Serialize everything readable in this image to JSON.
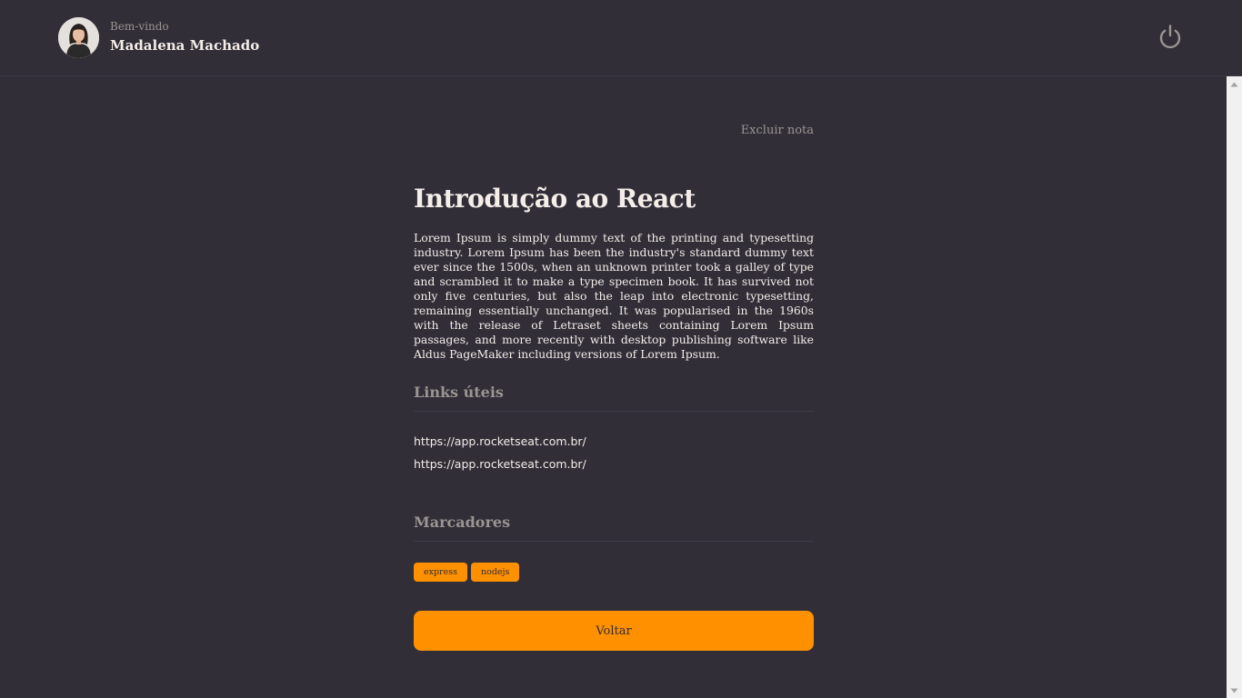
{
  "header": {
    "welcome_label": "Bem-vindo",
    "user_name": "Madalena Machado"
  },
  "note": {
    "delete_label": "Excluir nota",
    "title": "Introdução ao React",
    "body": "Lorem Ipsum is simply dummy text of the printing and typesetting industry. Lorem Ipsum has been the industry's standard dummy text ever since the 1500s, when an unknown printer took a galley of type and scrambled it to make a type specimen book. It has survived not only five centuries, but also the leap into electronic typesetting, remaining essentially unchanged. It was popularised in the 1960s with the release of Letraset sheets containing Lorem Ipsum passages, and more recently with desktop publishing software like Aldus PageMaker including versions of Lorem Ipsum."
  },
  "links_section": {
    "title": "Links úteis",
    "links": [
      "https://app.rocketseat.com.br/",
      "https://app.rocketseat.com.br/"
    ]
  },
  "tags_section": {
    "title": "Marcadores",
    "tags": [
      "express",
      "nodejs"
    ]
  },
  "back_button_label": "Voltar",
  "colors": {
    "background": "#312e38",
    "accent": "#ff9000",
    "text": "#f4ede8",
    "muted": "#999591"
  },
  "icons": {
    "logout": "power-icon"
  }
}
